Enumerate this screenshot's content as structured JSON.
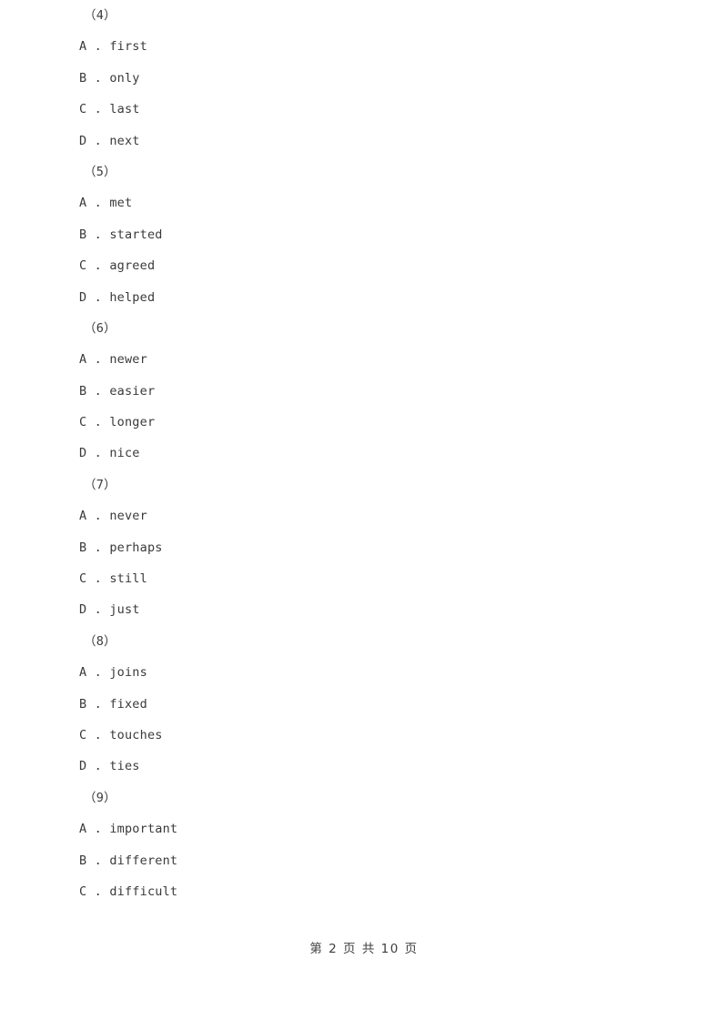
{
  "document": {
    "page_background": "#ffffff",
    "text_color": "#3a3a3a"
  },
  "questions": [
    {
      "number": "（4）",
      "options": [
        {
          "letter": "A",
          "separator": " . ",
          "text": "first"
        },
        {
          "letter": "B",
          "separator": " . ",
          "text": "only"
        },
        {
          "letter": "C",
          "separator": " . ",
          "text": "last"
        },
        {
          "letter": "D",
          "separator": " . ",
          "text": "next"
        }
      ]
    },
    {
      "number": "（5）",
      "options": [
        {
          "letter": "A",
          "separator": " . ",
          "text": "met"
        },
        {
          "letter": "B",
          "separator": " . ",
          "text": "started"
        },
        {
          "letter": "C",
          "separator": " . ",
          "text": "agreed"
        },
        {
          "letter": "D",
          "separator": " . ",
          "text": "helped"
        }
      ]
    },
    {
      "number": "（6）",
      "options": [
        {
          "letter": "A",
          "separator": " . ",
          "text": "newer"
        },
        {
          "letter": "B",
          "separator": " . ",
          "text": "easier"
        },
        {
          "letter": "C",
          "separator": " . ",
          "text": "longer"
        },
        {
          "letter": "D",
          "separator": " . ",
          "text": "nice"
        }
      ]
    },
    {
      "number": "（7）",
      "options": [
        {
          "letter": "A",
          "separator": " . ",
          "text": "never"
        },
        {
          "letter": "B",
          "separator": " . ",
          "text": "perhaps"
        },
        {
          "letter": "C",
          "separator": " . ",
          "text": "still"
        },
        {
          "letter": "D",
          "separator": " . ",
          "text": "just"
        }
      ]
    },
    {
      "number": "（8）",
      "options": [
        {
          "letter": "A",
          "separator": " . ",
          "text": "joins"
        },
        {
          "letter": "B",
          "separator": " . ",
          "text": "fixed"
        },
        {
          "letter": "C",
          "separator": " . ",
          "text": "touches"
        },
        {
          "letter": "D",
          "separator": " . ",
          "text": "ties"
        }
      ]
    },
    {
      "number": "（9）",
      "options": [
        {
          "letter": "A",
          "separator": " . ",
          "text": "important"
        },
        {
          "letter": "B",
          "separator": " . ",
          "text": "different"
        },
        {
          "letter": "C",
          "separator": " . ",
          "text": "difficult"
        }
      ]
    }
  ],
  "footer": {
    "page_label": "第 2 页 共 10 页"
  }
}
